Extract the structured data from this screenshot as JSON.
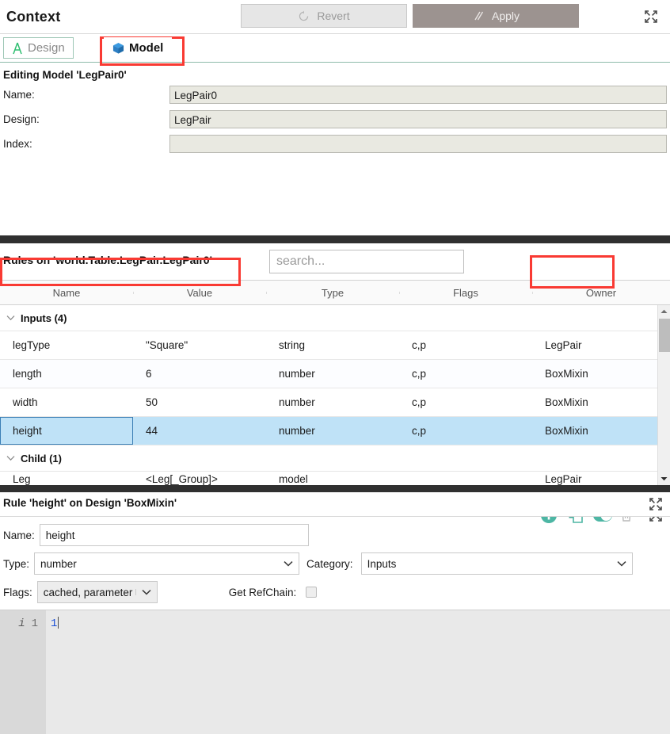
{
  "header": {
    "title": "Context",
    "revert_label": "Revert",
    "apply_label": "Apply",
    "revert_icon": "revert-circular-arrow-icon",
    "apply_icon": "double-slash-icon",
    "expand_icon": "expand-arrows-icon"
  },
  "tabs": [
    {
      "label": "Design",
      "icon": "compass-a-icon",
      "active": false
    },
    {
      "label": "Model",
      "icon": "blue-cube-icon",
      "active": true
    }
  ],
  "editing": {
    "title": "Editing Model 'LegPair0'",
    "fields": [
      {
        "label": "Name:",
        "value": "LegPair0"
      },
      {
        "label": "Design:",
        "value": "LegPair"
      },
      {
        "label": "Index:",
        "value": ""
      }
    ]
  },
  "rules": {
    "title": "Rules on 'world.Table.LegPair.LegPair0'",
    "search_placeholder": "search...",
    "tools": [
      {
        "name": "add-rule-button",
        "icon": "plus-circle-icon"
      },
      {
        "name": "duplicate-rule-button",
        "icon": "copy-pages-icon"
      },
      {
        "name": "toggle-switch",
        "icon": "toggle-on-icon"
      },
      {
        "name": "delete-rule-button",
        "icon": "trash-icon"
      },
      {
        "name": "expand-rules-button",
        "icon": "expand-arrows-icon"
      }
    ],
    "columns": [
      "Name",
      "Value",
      "Type",
      "Flags",
      "Owner"
    ],
    "groups": [
      {
        "label": "Inputs (4)",
        "rows": [
          {
            "name": "legType",
            "value": "\"Square\"",
            "type": "string",
            "flags": "c,p",
            "owner": "LegPair",
            "selected": false
          },
          {
            "name": "length",
            "value": "6",
            "type": "number",
            "flags": "c,p",
            "owner": "BoxMixin",
            "selected": false
          },
          {
            "name": "width",
            "value": "50",
            "type": "number",
            "flags": "c,p",
            "owner": "BoxMixin",
            "selected": false
          },
          {
            "name": "height",
            "value": "44",
            "type": "number",
            "flags": "c,p",
            "owner": "BoxMixin",
            "selected": true
          }
        ]
      },
      {
        "label": "Child (1)",
        "rows": [
          {
            "name": "Leg",
            "value": "<Leg[_Group]>",
            "type": "model",
            "flags": "",
            "owner": "LegPair",
            "selected": false
          }
        ]
      }
    ]
  },
  "rule_detail": {
    "title": "Rule 'height' on Design 'BoxMixin'",
    "expand_icon": "expand-arrows-icon",
    "name_label": "Name:",
    "name_value": "height",
    "type_label": "Type:",
    "type_value": "number",
    "category_label": "Category:",
    "category_value": "Inputs",
    "flags_label": "Flags:",
    "flags_value": "cached, parameter",
    "refchain_label": "Get RefChain:",
    "refchain_checked": false
  },
  "editor": {
    "gutter_marker": "i",
    "gutter_line": "1",
    "code_line": "1"
  },
  "colors": {
    "apply_bg": "#9c9390",
    "highlight": "#f93a33",
    "selection": "#bfe2f7",
    "accent_teal": "#4db6a4",
    "tab_underline": "#8fbcab",
    "code_blue": "#1a4fd6"
  }
}
